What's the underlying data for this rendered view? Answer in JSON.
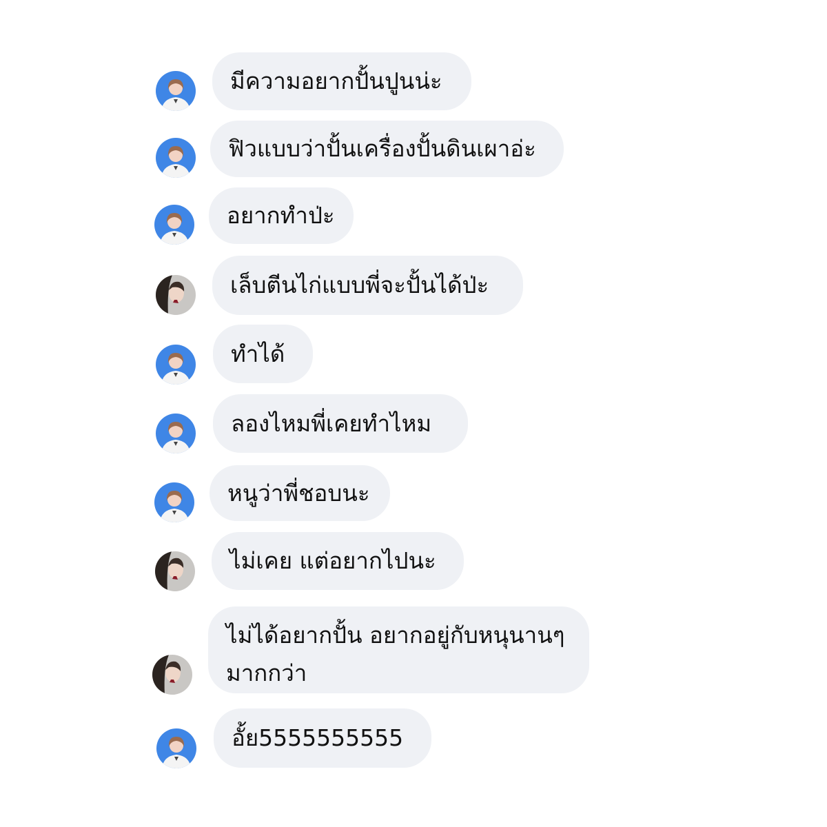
{
  "colors": {
    "background": "#ffffff",
    "bubble": "#eff1f5",
    "text": "#111111",
    "avatar_blue_bg": "#3f86e6",
    "avatar_gray_bg": "#c9c7c4"
  },
  "messages": [
    {
      "sender": "blue-avatar-user",
      "avatar_icon": "user-avatar-blue-icon",
      "text": "มีความอยากปั้นปูนน่ะ"
    },
    {
      "sender": "blue-avatar-user",
      "avatar_icon": "user-avatar-blue-icon",
      "text": "ฟิวแบบว่าปั้นเครื่องปั้นดินเผาอ่ะ"
    },
    {
      "sender": "blue-avatar-user",
      "avatar_icon": "user-avatar-blue-icon",
      "text": "อยากทำป่ะ"
    },
    {
      "sender": "gray-avatar-user",
      "avatar_icon": "user-avatar-gray-icon",
      "text": "เล็บตีนไก่แบบพี่จะปั้นได้ป่ะ"
    },
    {
      "sender": "blue-avatar-user",
      "avatar_icon": "user-avatar-blue-icon",
      "text": "ทำได้"
    },
    {
      "sender": "blue-avatar-user",
      "avatar_icon": "user-avatar-blue-icon",
      "text": "ลองไหมพี่เคยทำไหม"
    },
    {
      "sender": "blue-avatar-user",
      "avatar_icon": "user-avatar-blue-icon",
      "text": "หนูว่าพี่ชอบนะ"
    },
    {
      "sender": "gray-avatar-user",
      "avatar_icon": "user-avatar-gray-icon",
      "text": "ไม่เคย แต่อยากไปนะ"
    },
    {
      "sender": "gray-avatar-user",
      "avatar_icon": "user-avatar-gray-icon",
      "text": "ไม่ได้อยากปั้น อยากอยู่กับหนุนานๆ มากกว่า"
    },
    {
      "sender": "blue-avatar-user",
      "avatar_icon": "user-avatar-blue-icon",
      "text": "อั้ย5555555555"
    }
  ]
}
